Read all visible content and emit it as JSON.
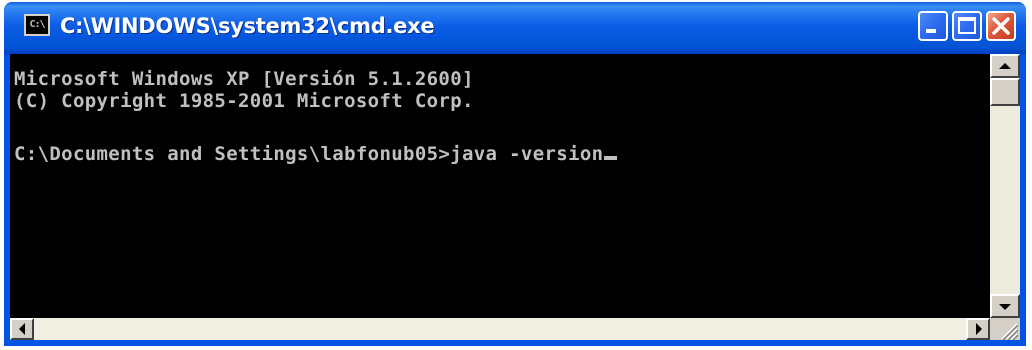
{
  "window": {
    "title": "C:\\WINDOWS\\system32\\cmd.exe",
    "icon": "cmd-console-icon",
    "icon_text": "C:\\",
    "controls": {
      "minimize": "minimize-icon",
      "maximize": "maximize-icon",
      "close": "close-icon"
    }
  },
  "console": {
    "lines": [
      "Microsoft Windows XP [Versión 5.1.2600]",
      "(C) Copyright 1985-2001 Microsoft Corp.",
      "",
      "C:\\Documents and Settings\\labfonub05>java -version"
    ],
    "text_color": "#c0c0c0",
    "background": "#000000"
  },
  "scrollbars": {
    "vertical": {
      "up": "arrow-up-icon",
      "down": "arrow-down-icon"
    },
    "horizontal": {
      "left": "arrow-left-icon",
      "right": "arrow-right-icon"
    }
  },
  "colors": {
    "titlebar": "#0054e3",
    "close_button": "#e0583a",
    "title_text": "#ffffff"
  }
}
